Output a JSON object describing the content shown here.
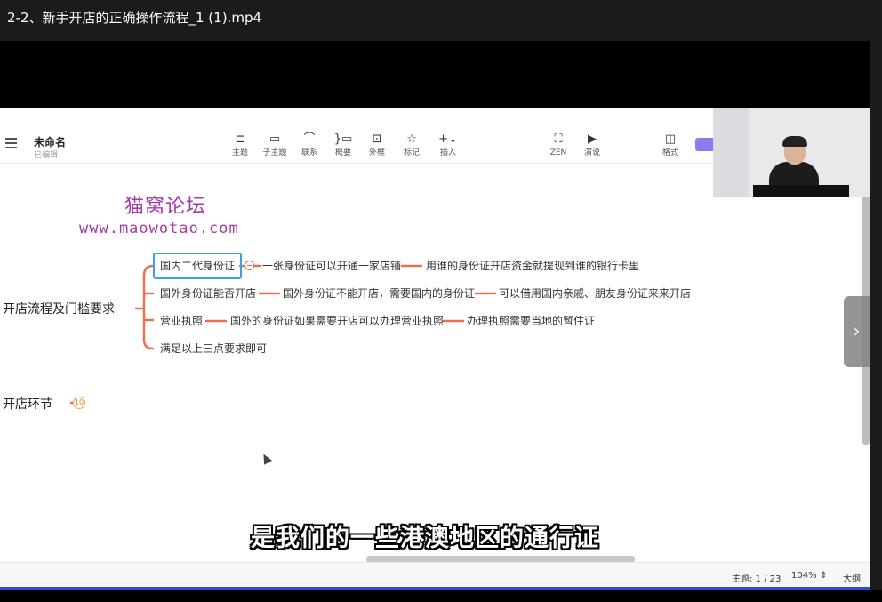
{
  "player": {
    "title": "2-2、新手开店的正确操作流程_1 (1).mp4"
  },
  "app": {
    "doc_title": "未命名",
    "doc_status": "已编辑",
    "toolbar": [
      {
        "icon": "topic-icon",
        "label": "主题"
      },
      {
        "icon": "subtopic-icon",
        "label": "子主题"
      },
      {
        "icon": "relation-icon",
        "label": "联系"
      },
      {
        "icon": "summary-icon",
        "label": "概要"
      },
      {
        "icon": "boundary-icon",
        "label": "外框"
      },
      {
        "icon": "marker-icon",
        "label": "标记"
      },
      {
        "icon": "insert-icon",
        "label": "插入"
      },
      {
        "icon": "zen-icon",
        "label": "ZEN"
      },
      {
        "icon": "present-icon",
        "label": "演说"
      },
      {
        "icon": "format-icon",
        "label": "格式"
      }
    ]
  },
  "watermark": {
    "line1": "猫窝论坛",
    "line2": "www.maowotao.com"
  },
  "mindmap": {
    "root1": "开店流程及门槛要求",
    "branches": [
      {
        "label": "国内二代身份证",
        "children": [
          "一张身份证可以开通一家店铺",
          "用谁的身份证开店资金就提现到谁的银行卡里"
        ]
      },
      {
        "label": "国外身份证能否开店",
        "children": [
          "国外身份证不能开店，需要国内的身份证",
          "可以借用国内亲戚、朋友身份证来来开店"
        ]
      },
      {
        "label": "营业执照",
        "children": [
          "国外的身份证如果需要开店可以办理营业执照",
          "办理执照需要当地的暂住证"
        ]
      },
      {
        "label": "满足以上三点要求即可",
        "children": []
      }
    ],
    "root2": "开店环节",
    "root2_count": "10"
  },
  "subtitle": "是我们的一些港澳地区的通行证",
  "statusbar": {
    "topic_label": "主题: 1 / 23",
    "zoom": "104%",
    "outline": "大纲"
  },
  "colors": {
    "branch": "#e8714f",
    "watermark": "#a13ba8",
    "selection": "#3aa1e8",
    "progress": "#2b4fd6"
  }
}
